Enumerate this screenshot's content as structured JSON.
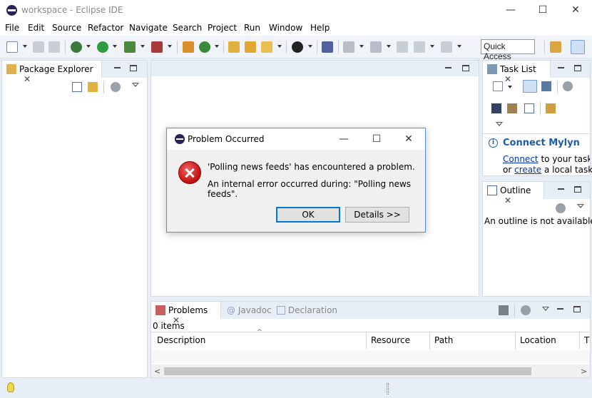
{
  "window": {
    "title": "workspace - Eclipse IDE",
    "minimize": "—",
    "maximize": "☐",
    "close": "✕"
  },
  "menu": [
    "File",
    "Edit",
    "Source",
    "Refactor",
    "Navigate",
    "Search",
    "Project",
    "Run",
    "Window",
    "Help"
  ],
  "toolbar": {
    "quick_access": "Quick Access"
  },
  "package_explorer": {
    "tab_label": "Package Explorer"
  },
  "task_list": {
    "tab_label": "Task List",
    "mylyn_title": "Connect Mylyn",
    "connect_link": "Connect",
    "connect_rest": " to your task ar",
    "or_text": "or ",
    "create_link": "create",
    "create_rest": " a local task."
  },
  "outline": {
    "tab_label": "Outline",
    "empty_text": "An outline is not available."
  },
  "problems": {
    "tab_problems": "Problems",
    "tab_javadoc": "Javadoc",
    "tab_declaration": "Declaration",
    "item_count": "0 items",
    "columns": [
      "Description",
      "Resource",
      "Path",
      "Location",
      "T"
    ]
  },
  "dialog": {
    "title": "Problem Occurred",
    "message": "'Polling news feeds' has encountered a problem.",
    "detail": "An internal error occurred during: \"Polling news feeds\".",
    "ok_label": "OK",
    "details_label": "Details >>"
  },
  "colors": {
    "accent": "#0078d7",
    "link": "#0033aa",
    "mylyn_title": "#1a5ea8",
    "error": "#c01010"
  }
}
